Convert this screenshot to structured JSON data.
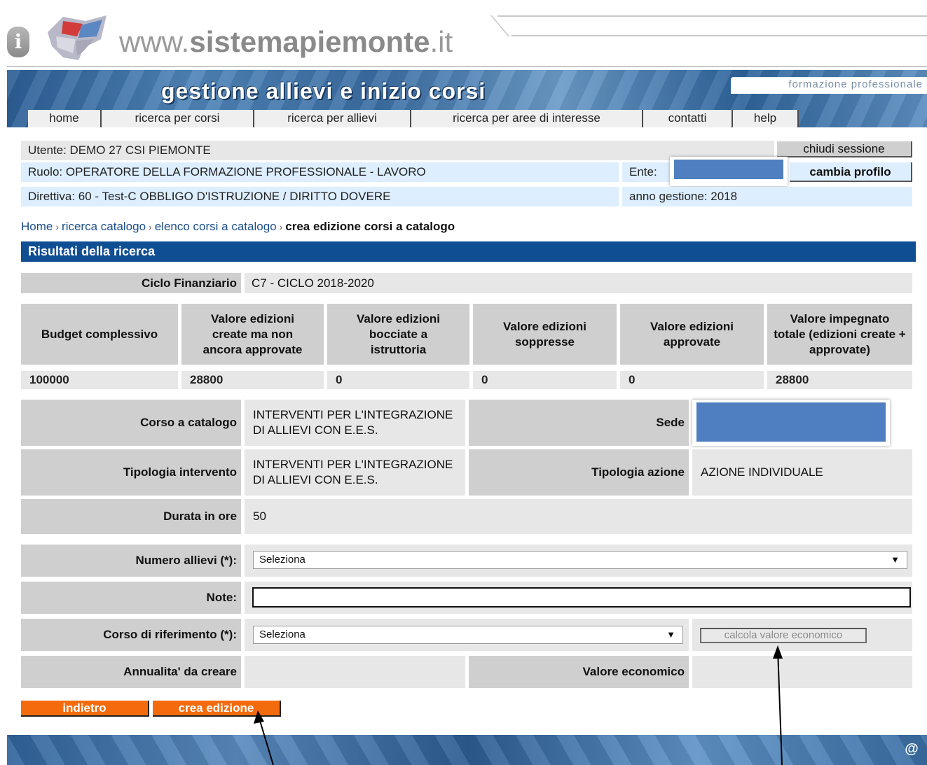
{
  "site": {
    "domain_prefix": "www.",
    "domain_bold": "sistemapiemonte",
    "domain_suffix": ".it",
    "info_glyph": "i"
  },
  "header": {
    "title": "gestione allievi e inizio corsi",
    "area": "formazione professionale",
    "nav": [
      "home",
      "ricerca per corsi",
      "ricerca per allievi",
      "ricerca per aree di interesse",
      "contatti",
      "help"
    ]
  },
  "user": {
    "utente": "Utente: DEMO 27 CSI PIEMONTE",
    "ruolo": "Ruolo: OPERATORE DELLA FORMAZIONE PROFESSIONALE - LAVORO",
    "ente": "Ente:",
    "direttiva": "Direttiva: 60 - Test-C OBBLIGO D'ISTRUZIONE / DIRITTO DOVERE",
    "anno": "anno gestione: 2018",
    "chiudi_label": "chiudi sessione",
    "cambia_label": "cambia profilo"
  },
  "breadcrumb": {
    "items": [
      "Home",
      "ricerca catalogo",
      "elenco corsi a catalogo"
    ],
    "current": "crea edizione corsi a catalogo",
    "separator": "›"
  },
  "results_title": "Risultati della ricerca",
  "ciclo": {
    "label": "Ciclo Finanziario",
    "value": "C7 - CICLO 2018-2020"
  },
  "budget_table": {
    "headers": [
      "Budget complessivo",
      "Valore edizioni create ma non ancora approvate",
      "Valore edizioni bocciate a istruttoria",
      "Valore edizioni soppresse",
      "Valore edizioni approvate",
      "Valore impegnato totale (edizioni create + approvate)"
    ],
    "values": [
      "100000",
      "28800",
      "0",
      "0",
      "0",
      "28800"
    ]
  },
  "course": {
    "corso_label": "Corso a catalogo",
    "corso_value": "INTERVENTI PER L'INTEGRAZIONE DI ALLIEVI CON E.E.S.",
    "sede_label": "Sede",
    "tipologia_intervento_label": "Tipologia intervento",
    "tipologia_intervento_value": "INTERVENTI PER L'INTEGRAZIONE DI ALLIEVI CON E.E.S.",
    "tipologia_azione_label": "Tipologia azione",
    "tipologia_azione_value": "AZIONE INDIVIDUALE",
    "durata_label": "Durata in ore",
    "durata_value": "50"
  },
  "form": {
    "numero_allievi_label": "Numero allievi (*):",
    "numero_allievi_value": "Seleziona",
    "note_label": "Note:",
    "note_value": "",
    "corso_rif_label": "Corso di riferimento (*):",
    "corso_rif_value": "Seleziona",
    "calcola_label": "calcola valore economico",
    "annualita_label": "Annualita' da creare",
    "valore_economico_label": "Valore economico"
  },
  "actions": {
    "indietro": "indietro",
    "crea": "crea edizione"
  },
  "footer": {
    "at_glyph": "@"
  },
  "colors": {
    "header_blue": "#0f4e92",
    "orange": "#f36b0c",
    "label_grey": "#cfcfcf",
    "value_grey": "#e7e7e7",
    "info_blue": "#ddeeff",
    "redact_blue": "#4f7fc0"
  }
}
